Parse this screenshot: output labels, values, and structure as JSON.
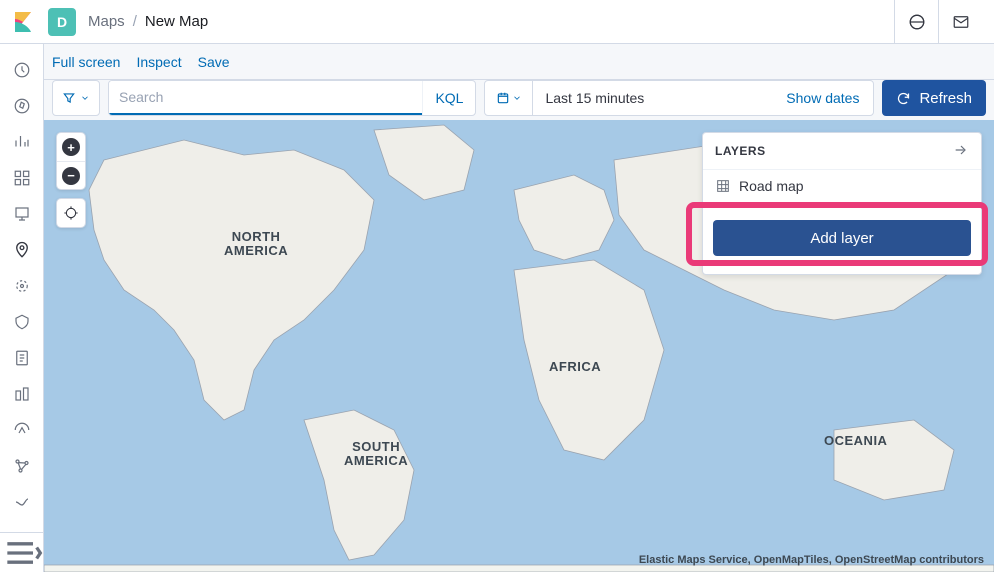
{
  "header": {
    "space_letter": "D",
    "breadcrumb_root": "Maps",
    "breadcrumb_current": "New Map"
  },
  "toolbar_links": {
    "fullscreen": "Full screen",
    "inspect": "Inspect",
    "save": "Save"
  },
  "search": {
    "placeholder": "Search",
    "lang_badge": "KQL"
  },
  "date": {
    "range_text": "Last 15 minutes",
    "show_dates": "Show dates"
  },
  "refresh_label": "Refresh",
  "map_labels": {
    "north_america": "NORTH\nAMERICA",
    "south_america": "SOUTH\nAMERICA",
    "africa": "AFRICA",
    "oceania": "OCEANIA"
  },
  "layers": {
    "title": "LAYERS",
    "items": [
      {
        "label": "Road map"
      }
    ],
    "add_label": "Add layer"
  },
  "attribution": "Elastic Maps Service, OpenMapTiles, OpenStreetMap contributors",
  "colors": {
    "primary": "#2d5aa0",
    "link": "#006bb4",
    "highlight": "#ea3a78",
    "ocean": "#a6c9e6",
    "land": "#efeee9"
  }
}
